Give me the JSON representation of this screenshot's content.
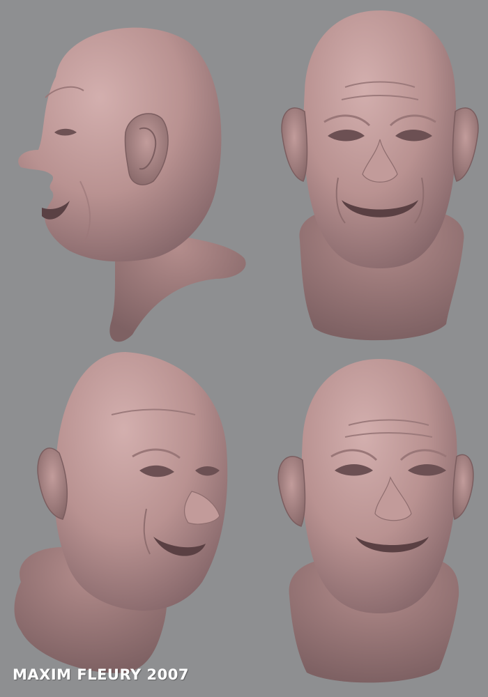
{
  "credit": "MAXIM FLEURY 2007",
  "colors": {
    "background": "#8e8f91",
    "skin_light": "#c9a3a2",
    "skin_mid": "#b08a89",
    "skin_dark": "#7d5f60",
    "credit_text": "#ffffff"
  },
  "views": [
    {
      "name": "side-profile-left"
    },
    {
      "name": "front-view"
    },
    {
      "name": "three-quarter-right"
    },
    {
      "name": "near-front-view"
    }
  ]
}
